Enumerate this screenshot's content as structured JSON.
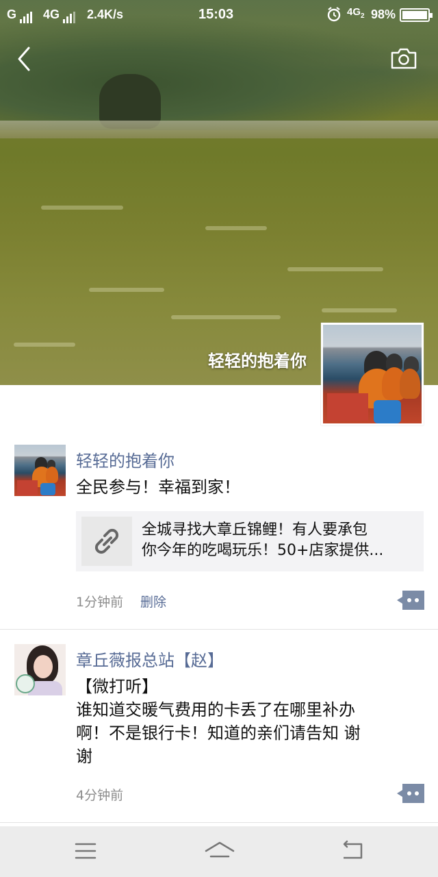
{
  "status_bar": {
    "carrier_1": "G",
    "carrier_2": "4G",
    "speed": "2.4K/s",
    "time": "15:03",
    "network_right": "4G",
    "battery": "98%"
  },
  "cover": {
    "name": "轻轻的抱着你",
    "icons": {
      "back": "back-arrow-icon",
      "camera": "camera-icon"
    }
  },
  "posts": [
    {
      "name": "轻轻的抱着你",
      "text": "全民参与！幸福到家！",
      "link": {
        "icon": "link-icon",
        "title_line1": "全城寻找大章丘锦鲤！有人要承包",
        "title_line2": "你今年的吃喝玩乐！50+店家提供..."
      },
      "time": "1分钟前",
      "delete_label": "删除"
    },
    {
      "name": "章丘薇报总站【赵】",
      "text_line1": "【微打听】",
      "text_line2": "谁知道交暖气费用的卡丢了在哪里补办",
      "text_line3": "啊！不是银行卡！知道的亲们请告知 谢",
      "text_line4": "谢",
      "time": "4分钟前"
    }
  ],
  "nav": {
    "menu": "menu-icon",
    "home": "home-icon",
    "back": "back-icon"
  },
  "colors": {
    "name_link": "#576b95",
    "nav_bg": "#ececec"
  }
}
